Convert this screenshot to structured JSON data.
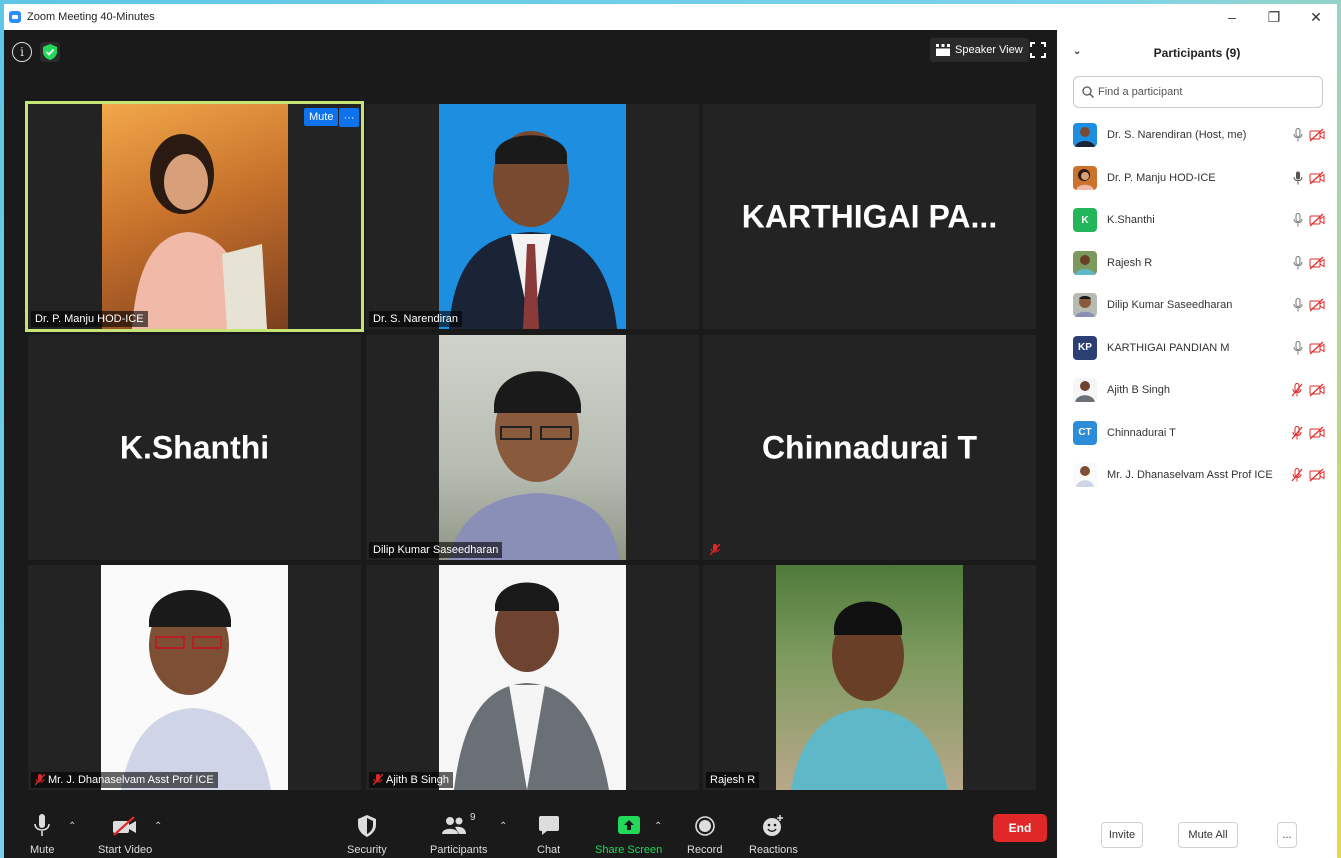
{
  "window": {
    "title": "Zoom Meeting 40-Minutes",
    "minimize": "–",
    "restore": "❐",
    "close": "✕"
  },
  "stage": {
    "speaker_view_label": "Speaker View",
    "tiles": [
      {
        "name": "Dr. P. Manju HOD-ICE",
        "mute_btn": "Mute",
        "more_btn": "···"
      },
      {
        "name": "Dr. S. Narendiran"
      },
      {
        "big_name": "KARTHIGAI  PA..."
      },
      {
        "big_name": "K.Shanthi"
      },
      {
        "name": "Dilip Kumar Saseedharan"
      },
      {
        "big_name": "Chinnadurai T"
      },
      {
        "name": "Mr. J. Dhanaselvam Asst Prof ICE"
      },
      {
        "name": "Ajith B Singh"
      },
      {
        "name": "Rajesh R"
      }
    ]
  },
  "toolbar": {
    "mute": "Mute",
    "start_video": "Start Video",
    "security": "Security",
    "participants": "Participants",
    "participants_count": "9",
    "chat": "Chat",
    "share_screen": "Share Screen",
    "record": "Record",
    "reactions": "Reactions",
    "end": "End"
  },
  "panel": {
    "title": "Participants (9)",
    "search_placeholder": "Find a participant",
    "participants": [
      {
        "name": "Dr. S. Narendiran (Host, me)",
        "initials": "",
        "mic": "on"
      },
      {
        "name": "Dr. P. Manju HOD-ICE",
        "initials": "",
        "mic": "active"
      },
      {
        "name": "K.Shanthi",
        "initials": "K",
        "mic": "on"
      },
      {
        "name": "Rajesh R",
        "initials": "",
        "mic": "on"
      },
      {
        "name": "Dilip Kumar Saseedharan",
        "initials": "",
        "mic": "on"
      },
      {
        "name": "KARTHIGAI PANDIAN M",
        "initials": "KP",
        "mic": "on"
      },
      {
        "name": "Ajith B Singh",
        "initials": "",
        "mic": "muted"
      },
      {
        "name": "Chinnadurai T",
        "initials": "CT",
        "mic": "muted"
      },
      {
        "name": "Mr. J. Dhanaselvam Asst Prof ICE",
        "initials": "",
        "mic": "muted"
      }
    ],
    "invite": "Invite",
    "mute_all": "Mute All",
    "more": "..."
  },
  "colors": {
    "accent_blue": "#0e72ed",
    "end_red": "#e02828",
    "active_speaker": "#c6e375",
    "share_green": "#23d959",
    "video_off_red": "#e02828"
  }
}
